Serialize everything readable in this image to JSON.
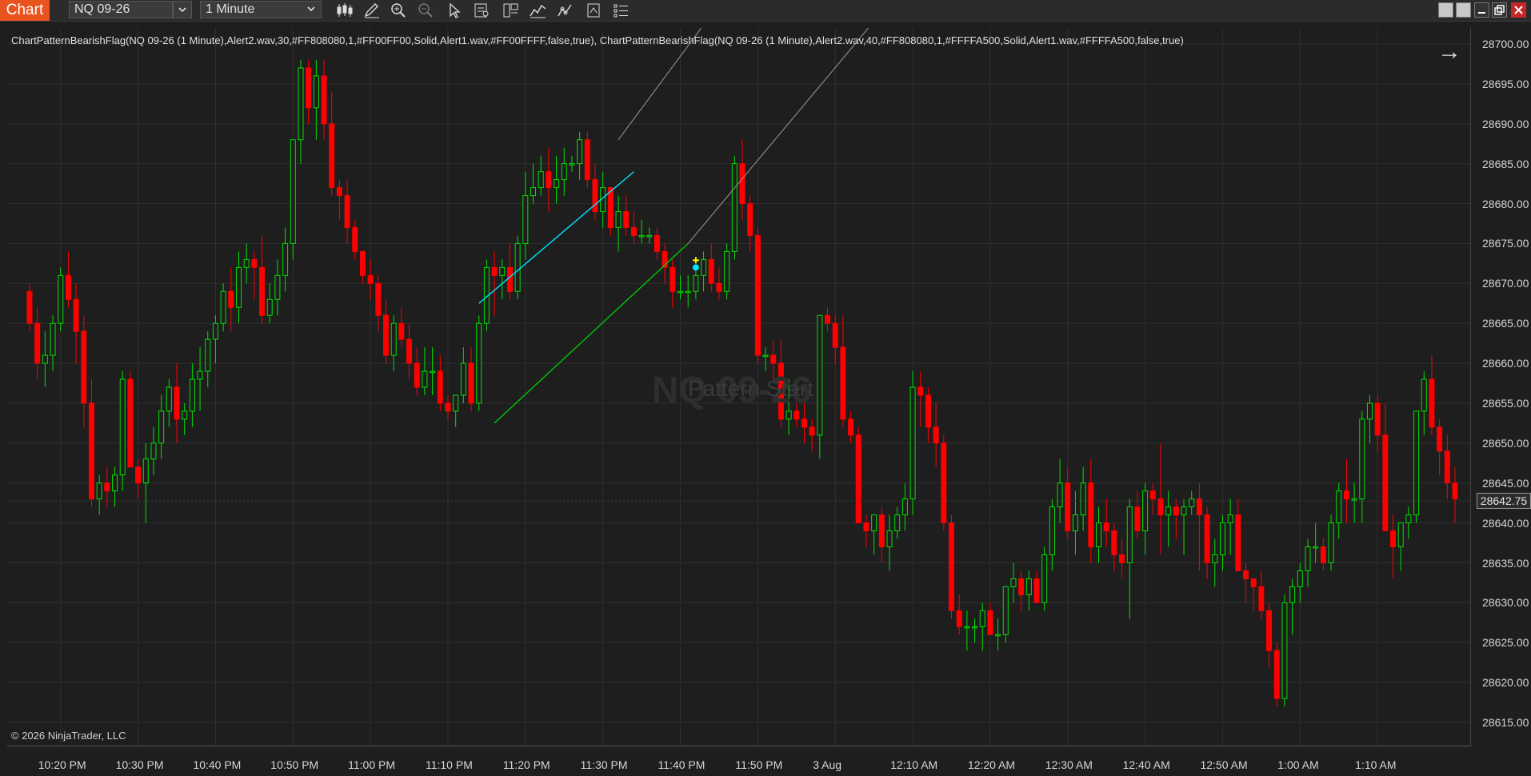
{
  "toolbar": {
    "tab_label": "Chart",
    "instrument": "NQ 09-26",
    "interval": "1 Minute"
  },
  "indicator_text": "ChartPatternBearishFlag(NQ 09-26 (1 Minute),Alert2.wav,30,#FF808080,1,#FF00FF00,Solid,Alert1.wav,#FF00FFFF,false,true), ChartPatternBearishFlag(NQ 09-26 (1 Minute),Alert2.wav,40,#FF808080,1,#FFFFA500,Solid,Alert1.wav,#FFFFA500,false,true)",
  "copyright": "© 2026 NinjaTrader, LLC",
  "watermark": "NQ 09-26",
  "watermark2": "Pattern Start",
  "current_price": "28642.75",
  "colors": {
    "up_candle": "#00e000",
    "down_candle": "#ff0000",
    "background": "#1e1e1e",
    "grid": "#2f2f2f",
    "flag_upper": "#00e5ff",
    "flag_lower": "#00c800",
    "projection": "#9a9a9a",
    "tab": "#e8531f"
  },
  "chart_data": {
    "type": "candlestick",
    "ylim": [
      28612,
      28702
    ],
    "price_ticks": [
      "28700.00",
      "28695.00",
      "28690.00",
      "28685.00",
      "28680.00",
      "28675.00",
      "28670.00",
      "28665.00",
      "28660.00",
      "28655.00",
      "28650.00",
      "28645.00",
      "28640.00",
      "28635.00",
      "28630.00",
      "28625.00",
      "28620.00",
      "28615.00"
    ],
    "time_ticks": [
      "10:20 PM",
      "10:30 PM",
      "10:40 PM",
      "10:50 PM",
      "11:00 PM",
      "11:10 PM",
      "11:20 PM",
      "11:30 PM",
      "11:40 PM",
      "11:50 PM",
      "3 Aug",
      "12:10 AM",
      "12:20 AM",
      "12:30 AM",
      "12:40 AM",
      "12:50 AM",
      "1:00 AM",
      "1:10 AM"
    ],
    "candles": [
      [
        28669,
        28670,
        28664,
        28665
      ],
      [
        28665,
        28667,
        28658,
        28660
      ],
      [
        28660,
        28664,
        28657,
        28661
      ],
      [
        28661,
        28666,
        28659,
        28665
      ],
      [
        28665,
        28672,
        28664,
        28671
      ],
      [
        28671,
        28674,
        28667,
        28668
      ],
      [
        28668,
        28670,
        28660,
        28664
      ],
      [
        28664,
        28666,
        28652,
        28655
      ],
      [
        28655,
        28658,
        28642,
        28643
      ],
      [
        28643,
        28646,
        28641,
        28645
      ],
      [
        28645,
        28647,
        28642,
        28644
      ],
      [
        28644,
        28647,
        28642,
        28646
      ],
      [
        28646,
        28659,
        28644,
        28658
      ],
      [
        28658,
        28659,
        28647,
        28647
      ],
      [
        28647,
        28648,
        28643,
        28645
      ],
      [
        28645,
        28650,
        28640,
        28648
      ],
      [
        28648,
        28652,
        28646,
        28650
      ],
      [
        28650,
        28656,
        28648,
        28654
      ],
      [
        28654,
        28658,
        28652,
        28657
      ],
      [
        28657,
        28660,
        28650,
        28653
      ],
      [
        28653,
        28655,
        28651,
        28654
      ],
      [
        28654,
        28660,
        28652,
        28658
      ],
      [
        28658,
        28662,
        28654,
        28659
      ],
      [
        28659,
        28664,
        28657,
        28663
      ],
      [
        28663,
        28666,
        28660,
        28665
      ],
      [
        28665,
        28670,
        28664,
        28669
      ],
      [
        28669,
        28672,
        28664,
        28667
      ],
      [
        28667,
        28674,
        28665,
        28672
      ],
      [
        28672,
        28675,
        28670,
        28673
      ],
      [
        28673,
        28674,
        28668,
        28672
      ],
      [
        28672,
        28676,
        28665,
        28666
      ],
      [
        28666,
        28670,
        28665,
        28668
      ],
      [
        28668,
        28673,
        28666,
        28671
      ],
      [
        28671,
        28677,
        28669,
        28675
      ],
      [
        28675,
        28688,
        28673,
        28688
      ],
      [
        28688,
        28698,
        28685,
        28697
      ],
      [
        28697,
        28698,
        28690,
        28692
      ],
      [
        28692,
        28698,
        28688,
        28696
      ],
      [
        28696,
        28698,
        28688,
        28690
      ],
      [
        28690,
        28694,
        28681,
        28682
      ],
      [
        28682,
        28683,
        28678,
        28681
      ],
      [
        28681,
        28683,
        28675,
        28677
      ],
      [
        28677,
        28678,
        28673,
        28674
      ],
      [
        28674,
        28674,
        28670,
        28671
      ],
      [
        28671,
        28673,
        28668,
        28670
      ],
      [
        28670,
        28671,
        28664,
        28666
      ],
      [
        28666,
        28668,
        28660,
        28661
      ],
      [
        28661,
        28666,
        28659,
        28665
      ],
      [
        28665,
        28667,
        28662,
        28663
      ],
      [
        28663,
        28665,
        28658,
        28660
      ],
      [
        28660,
        28662,
        28656,
        28657
      ],
      [
        28657,
        28662,
        28656,
        28659
      ],
      [
        28659,
        28662,
        28656,
        28659
      ],
      [
        28659,
        28661,
        28654,
        28655
      ],
      [
        28655,
        28656,
        28653,
        28654
      ],
      [
        28654,
        28656,
        28652,
        28656
      ],
      [
        28656,
        28662,
        28655,
        28660
      ],
      [
        28660,
        28662,
        28654,
        28655
      ],
      [
        28655,
        28666,
        28654,
        28665
      ],
      [
        28665,
        28673,
        28664,
        28672
      ],
      [
        28672,
        28674,
        28666,
        28671
      ],
      [
        28671,
        28673,
        28668,
        28672
      ],
      [
        28672,
        28675,
        28668,
        28669
      ],
      [
        28669,
        28676,
        28668,
        28675
      ],
      [
        28675,
        28684,
        28673,
        28681
      ],
      [
        28681,
        28685,
        28680,
        28682
      ],
      [
        28682,
        28686,
        28681,
        28684
      ],
      [
        28684,
        28687,
        28679,
        28682
      ],
      [
        28682,
        28686,
        28680,
        28683
      ],
      [
        28683,
        28687,
        28681,
        28685
      ],
      [
        28685,
        28686,
        28684,
        28685
      ],
      [
        28685,
        28689,
        28683,
        28688
      ],
      [
        28688,
        28689,
        28682,
        28683
      ],
      [
        28683,
        28685,
        28678,
        28679
      ],
      [
        28679,
        28684,
        28677,
        28682
      ],
      [
        28682,
        28682,
        28676,
        28677
      ],
      [
        28677,
        28681,
        28674,
        28679
      ],
      [
        28679,
        28681,
        28676,
        28677
      ],
      [
        28677,
        28679,
        28675,
        28676
      ],
      [
        28676,
        28678,
        28675,
        28676
      ],
      [
        28676,
        28677,
        28675,
        28676
      ],
      [
        28676,
        28677,
        28673,
        28674
      ],
      [
        28674,
        28675,
        28670,
        28672
      ],
      [
        28672,
        28673,
        28667,
        28669
      ],
      [
        28669,
        28671,
        28668,
        28669
      ],
      [
        28669,
        28671,
        28667,
        28669
      ],
      [
        28669,
        28672,
        28668,
        28671
      ],
      [
        28671,
        28674,
        28669,
        28673
      ],
      [
        28673,
        28675,
        28669,
        28670
      ],
      [
        28670,
        28672,
        28668,
        28669
      ],
      [
        28669,
        28675,
        28668,
        28674
      ],
      [
        28674,
        28686,
        28673,
        28685
      ],
      [
        28685,
        28688,
        28678,
        28680
      ],
      [
        28680,
        28681,
        28674,
        28676
      ],
      [
        28676,
        28677,
        28660,
        28661
      ],
      [
        28661,
        28662,
        28659,
        28661
      ],
      [
        28661,
        28663,
        28658,
        28660
      ],
      [
        28660,
        28663,
        28652,
        28653
      ],
      [
        28653,
        28658,
        28651,
        28654
      ],
      [
        28654,
        28655,
        28652,
        28653
      ],
      [
        28653,
        28655,
        28650,
        28652
      ],
      [
        28652,
        28653,
        28649,
        28651
      ],
      [
        28651,
        28666,
        28648,
        28666
      ],
      [
        28666,
        28667,
        28664,
        28665
      ],
      [
        28665,
        28666,
        28660,
        28662
      ],
      [
        28662,
        28666,
        28652,
        28653
      ],
      [
        28653,
        28654,
        28650,
        28651
      ],
      [
        28651,
        28652,
        28640,
        28640
      ],
      [
        28640,
        28641,
        28637,
        28639
      ],
      [
        28639,
        28641,
        28636,
        28641
      ],
      [
        28641,
        28642,
        28635,
        28637
      ],
      [
        28637,
        28641,
        28634,
        28639
      ],
      [
        28639,
        28642,
        28638,
        28641
      ],
      [
        28641,
        28645,
        28639,
        28643
      ],
      [
        28643,
        28659,
        28641,
        28657
      ],
      [
        28657,
        28659,
        28652,
        28656
      ],
      [
        28656,
        28657,
        28650,
        28652
      ],
      [
        28652,
        28655,
        28647,
        28650
      ],
      [
        28650,
        28651,
        28639,
        28640
      ],
      [
        28640,
        28641,
        28628,
        28629
      ],
      [
        28629,
        28631,
        28626,
        28627
      ],
      [
        28627,
        28629,
        28624,
        28627
      ],
      [
        28627,
        28628,
        28625,
        28627
      ],
      [
        28627,
        28630,
        28624,
        28629
      ],
      [
        28629,
        28630,
        28626,
        28626
      ],
      [
        28626,
        28628,
        28624,
        28626
      ],
      [
        28626,
        28632,
        28625,
        28632
      ],
      [
        28632,
        28635,
        28630,
        28633
      ],
      [
        28633,
        28634,
        28629,
        28631
      ],
      [
        28631,
        28634,
        28629,
        28633
      ],
      [
        28633,
        28634,
        28630,
        28630
      ],
      [
        28630,
        28637,
        28629,
        28636
      ],
      [
        28636,
        28643,
        28634,
        28642
      ],
      [
        28642,
        28648,
        28640,
        28645
      ],
      [
        28645,
        28647,
        28638,
        28639
      ],
      [
        28639,
        28644,
        28636,
        28641
      ],
      [
        28641,
        28647,
        28639,
        28645
      ],
      [
        28645,
        28648,
        28635,
        28637
      ],
      [
        28637,
        28642,
        28635,
        28640
      ],
      [
        28640,
        28643,
        28637,
        28639
      ],
      [
        28639,
        28640,
        28634,
        28636
      ],
      [
        28636,
        28638,
        28633,
        28635
      ],
      [
        28635,
        28643,
        28628,
        28642
      ],
      [
        28642,
        28644,
        28638,
        28639
      ],
      [
        28639,
        28645,
        28636,
        28644
      ],
      [
        28644,
        28645,
        28641,
        28643
      ],
      [
        28643,
        28650,
        28636,
        28641
      ],
      [
        28641,
        28644,
        28637,
        28642
      ],
      [
        28642,
        28643,
        28638,
        28641
      ],
      [
        28641,
        28643,
        28636,
        28642
      ],
      [
        28642,
        28644,
        28641,
        28643
      ],
      [
        28643,
        28645,
        28634,
        28641
      ],
      [
        28641,
        28642,
        28633,
        28635
      ],
      [
        28635,
        28638,
        28632,
        28636
      ],
      [
        28636,
        28641,
        28634,
        28640
      ],
      [
        28640,
        28643,
        28636,
        28641
      ],
      [
        28641,
        28643,
        28634,
        28634
      ],
      [
        28634,
        28635,
        28630,
        28633
      ],
      [
        28633,
        28633,
        28629,
        28632
      ],
      [
        28632,
        28634,
        28628,
        28629
      ],
      [
        28629,
        28630,
        28622,
        28624
      ],
      [
        28624,
        28625,
        28617,
        28618
      ],
      [
        28618,
        28631,
        28617,
        28630
      ],
      [
        28630,
        28633,
        28626,
        28632
      ],
      [
        28632,
        28635,
        28630,
        28634
      ],
      [
        28634,
        28638,
        28632,
        28637
      ],
      [
        28637,
        28640,
        28635,
        28637
      ],
      [
        28637,
        28638,
        28634,
        28635
      ],
      [
        28635,
        28641,
        28634,
        28640
      ],
      [
        28640,
        28645,
        28638,
        28644
      ],
      [
        28644,
        28648,
        28640,
        28643
      ],
      [
        28643,
        28645,
        28640,
        28643
      ],
      [
        28643,
        28654,
        28640,
        28653
      ],
      [
        28653,
        28656,
        28650,
        28655
      ],
      [
        28655,
        28656,
        28649,
        28651
      ],
      [
        28651,
        28655,
        28640,
        28639
      ],
      [
        28639,
        28641,
        28633,
        28637
      ],
      [
        28637,
        28640,
        28634,
        28640
      ],
      [
        28640,
        28642,
        28638,
        28641
      ],
      [
        28641,
        28654,
        28640,
        28654
      ],
      [
        28654,
        28659,
        28651,
        28658
      ],
      [
        28658,
        28661,
        28651,
        28652
      ],
      [
        28652,
        28653,
        28646,
        28649
      ],
      [
        28649,
        28651,
        28643,
        28645
      ],
      [
        28645,
        28647,
        28640,
        28643
      ]
    ],
    "flag_upper": {
      "from": [
        58,
        28667.5
      ],
      "to": [
        78,
        28684
      ]
    },
    "flag_lower": {
      "from": [
        60,
        28652.5
      ],
      "to": [
        85,
        28675
      ]
    },
    "projections": [
      {
        "from": [
          76,
          28688
        ],
        "to": [
          89,
          28705
        ]
      },
      {
        "from": [
          85,
          28675
        ],
        "to": [
          110,
          28704
        ]
      }
    ],
    "signal_marker": {
      "index": 86,
      "price": 28672
    }
  }
}
